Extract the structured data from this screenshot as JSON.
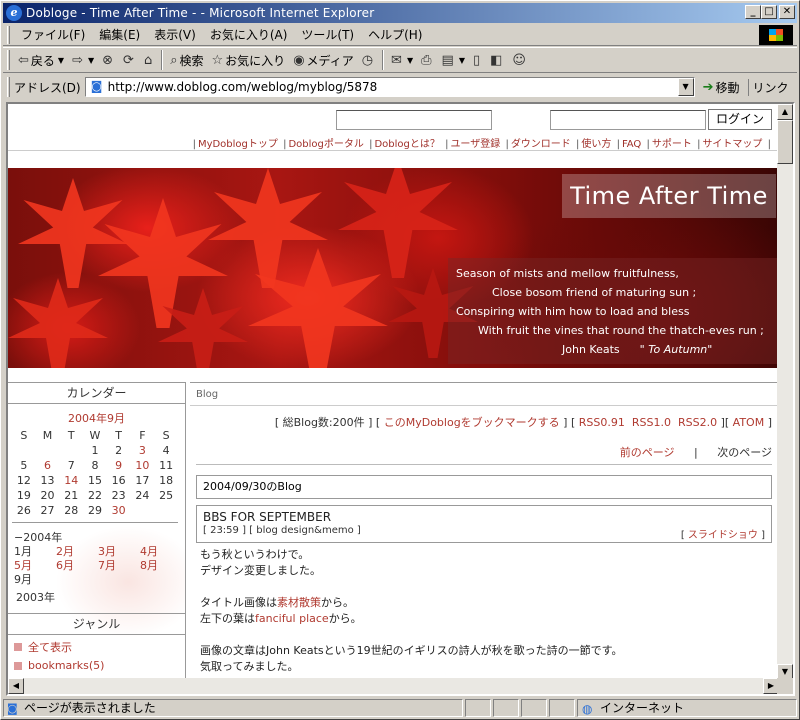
{
  "window": {
    "title": "Dobloge - Time After Time - - Microsoft Internet Explorer",
    "app_icon": "ie-icon",
    "min": "_",
    "max": "□",
    "close": "✕"
  },
  "menu": [
    "ファイル(F)",
    "編集(E)",
    "表示(V)",
    "お気に入り(A)",
    "ツール(T)",
    "ヘルプ(H)"
  ],
  "toolbar": {
    "back": "戻る",
    "search": "検索",
    "favorites": "お気に入り",
    "media": "メディア"
  },
  "address": {
    "label": "アドレス(D)",
    "url": "http://www.doblog.com/weblog/myblog/5878",
    "go": "移動",
    "links": "リンク"
  },
  "header": {
    "login": "ログイン",
    "nav": [
      "MyDoblogトップ",
      "Doblogポータル",
      "Doblogとは？",
      "ユーザ登録",
      "ダウンロード",
      "使い方",
      "FAQ",
      "サポート",
      "サイトマップ"
    ]
  },
  "banner": {
    "title": "Time After Time",
    "poem": [
      "Season of mists and mellow fruitfulness,",
      "Close bosom friend of maturing sun ;",
      "Conspiring with him how to load and bless",
      "With fruit the vines that round the thatch-eves run ;",
      "John Keats",
      "\" To Autumn\""
    ]
  },
  "calendar": {
    "title": "カレンダー",
    "month": "2004年9月",
    "weekdays": [
      "S",
      "M",
      "T",
      "W",
      "T",
      "F",
      "S"
    ],
    "weeks": [
      [
        "",
        "",
        "",
        "1",
        "2",
        "3",
        "4"
      ],
      [
        "5",
        "6",
        "7",
        "8",
        "9",
        "10",
        "11"
      ],
      [
        "12",
        "13",
        "14",
        "15",
        "16",
        "17",
        "18"
      ],
      [
        "19",
        "20",
        "21",
        "22",
        "23",
        "24",
        "25"
      ],
      [
        "26",
        "27",
        "28",
        "29",
        "30",
        "",
        ""
      ]
    ],
    "linked_days": [
      "3",
      "6",
      "9",
      "10",
      "14",
      "30"
    ],
    "year": "−2004年",
    "months": [
      {
        "label": "1月",
        "link": false
      },
      {
        "label": "2月",
        "link": true
      },
      {
        "label": "3月",
        "link": true
      },
      {
        "label": "4月",
        "link": true
      },
      {
        "label": "5月",
        "link": true
      },
      {
        "label": "6月",
        "link": true
      },
      {
        "label": "7月",
        "link": true
      },
      {
        "label": "8月",
        "link": true
      },
      {
        "label": "9月",
        "link": false
      }
    ],
    "prev_year": "2003年"
  },
  "genre": {
    "title": "ジャンル",
    "items": [
      "全て表示",
      "bookmarks(5)"
    ]
  },
  "blog": {
    "section": "Blog",
    "count": "[ 総Blog数:200件 ]",
    "bookmark": "このMyDoblogをブックマークする",
    "rss": [
      "RSS0.91",
      "RSS1.0",
      "RSS2.0"
    ],
    "atom": "ATOM",
    "prev": "前のページ",
    "sep": "|",
    "next": "次のページ",
    "date": "2004/09/30のBlog",
    "entry": {
      "title": "BBS FOR SEPTEMBER",
      "meta": "[ 23:59 ] [ blog design&memo ]",
      "slideshow": "スライドショウ",
      "body": [
        "もう秋というわけで。",
        "デザイン変更しました。",
        "",
        "タイトル画像は",
        "素材散策",
        "から。",
        "左下の葉は",
        "fanciful place",
        "から。",
        "",
        "画像の文章はJohn Keatsという19世紀のイギリスの詩人が秋を歌った詩の一節です。",
        "気取ってみました。"
      ]
    }
  },
  "status": {
    "text": "ページが表示されました",
    "zone": "インターネット"
  },
  "colors": {
    "link": "#b03a30",
    "titlebar": "#0a246a"
  }
}
